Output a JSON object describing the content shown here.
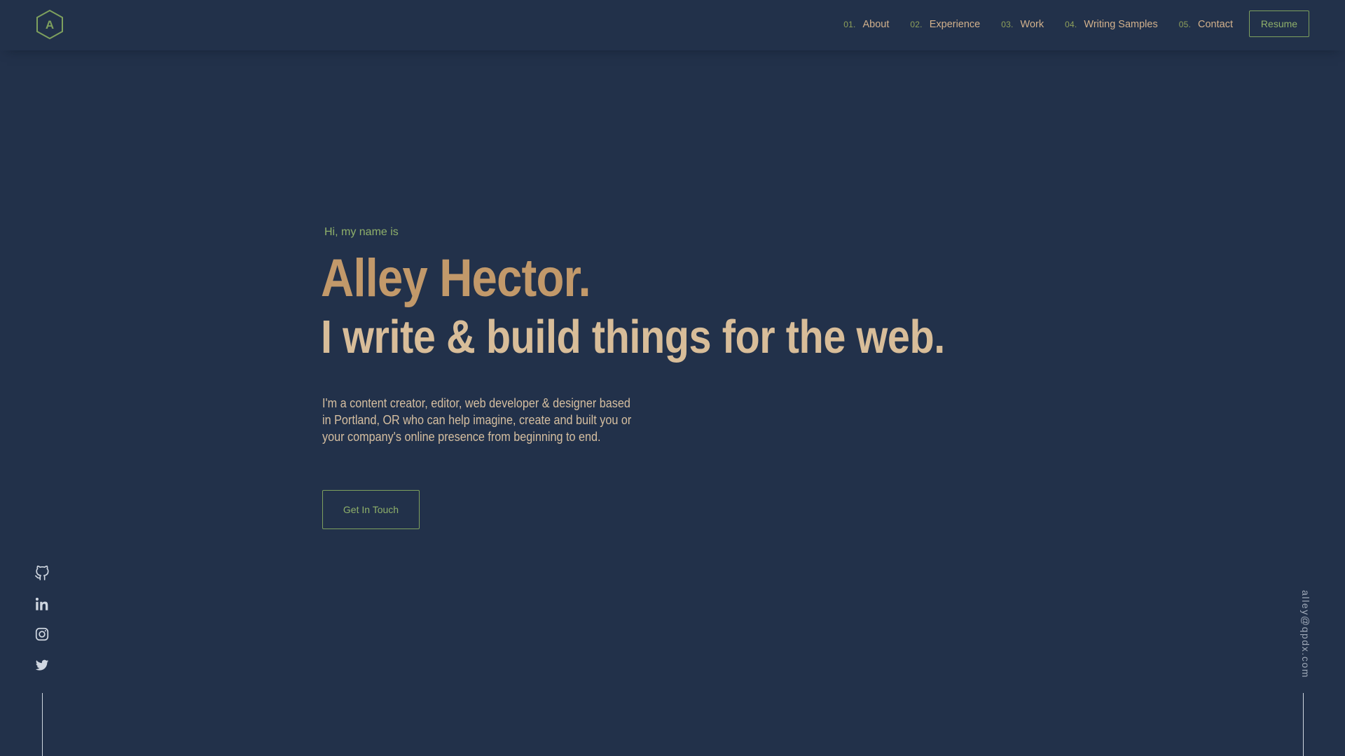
{
  "brand": {
    "logo_letter": "A",
    "logo_color": "#7ea05e"
  },
  "nav": {
    "items": [
      {
        "num": "01.",
        "label": "About"
      },
      {
        "num": "02.",
        "label": "Experience"
      },
      {
        "num": "03.",
        "label": "Work"
      },
      {
        "num": "04.",
        "label": "Writing Samples"
      },
      {
        "num": "05.",
        "label": "Contact"
      }
    ],
    "resume_label": "Resume"
  },
  "hero": {
    "greeting": "Hi, my name is",
    "name": "Alley Hector.",
    "tagline": "I write & build things for the web.",
    "description": "I'm a content creator, editor, web developer & designer based in Portland, OR who can help imagine, create and built you or your company's online presence from beginning to end.",
    "cta_label": "Get In Touch"
  },
  "social": {
    "links": [
      {
        "icon": "github-icon"
      },
      {
        "icon": "linkedin-icon"
      },
      {
        "icon": "instagram-icon"
      },
      {
        "icon": "twitter-icon"
      }
    ]
  },
  "contact": {
    "email": "alley@qpdx.com"
  },
  "colors": {
    "background": "#22314a",
    "accent_green": "#8fb06a",
    "name_tan": "#c2996a",
    "tagline_tan": "#d8bd99",
    "text_tan": "#d6bfa0",
    "muted": "#9fa9b8"
  }
}
